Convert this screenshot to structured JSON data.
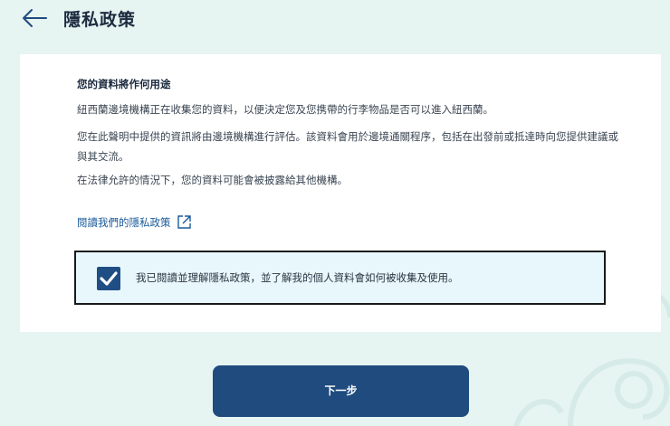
{
  "header": {
    "title": "隱私政策",
    "back_icon": "arrow-left-icon"
  },
  "card": {
    "heading": "您的資料將作何用途",
    "paragraphs": [
      "紐西蘭邊境機構正在收集您的資料，以便決定您及您携帶的行李物品是否可以進入紐西蘭。",
      "您在此聲明中提供的資訊將由邊境機構進行評估。該資料會用於邊境通關程序，包括在出發前或抵達時向您提供建議或與其交流。",
      "在法律允許的情況下，您的資料可能會被披露給其他機構。"
    ],
    "link": {
      "label": "閱讀我們的隱私政策",
      "icon": "external-link-icon"
    },
    "consent": {
      "label": "我已閱讀並理解隱私政策，並了解我的個人資料會如何被收集及使用。",
      "checked": true
    }
  },
  "actions": {
    "next_label": "下一步"
  },
  "colors": {
    "background": "#e6f4f2",
    "primary": "#1f4b7e",
    "link": "#1a5a9a",
    "consent_bg": "#e8f7fb"
  }
}
